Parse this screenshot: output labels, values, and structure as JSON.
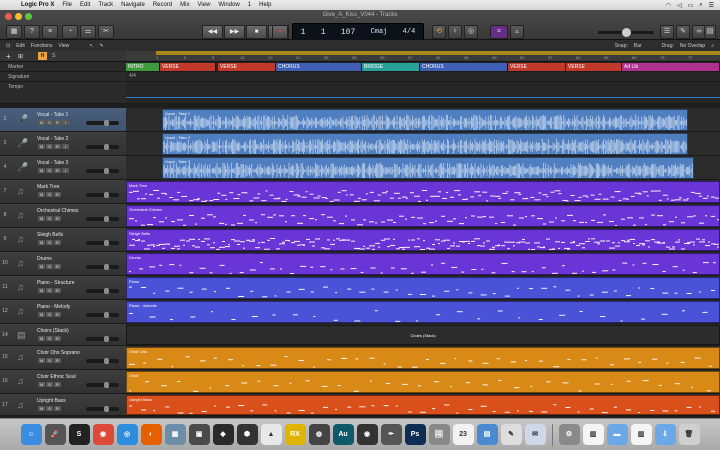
{
  "menubar": {
    "apple": "",
    "app": "Logic Pro X",
    "items": [
      "File",
      "Edit",
      "Track",
      "Navigate",
      "Record",
      "Mix",
      "View",
      "Window",
      "1",
      "Help"
    ]
  },
  "window": {
    "title": "Give_A_Kiss_V044 - Tracks"
  },
  "transport": {
    "rewind": "◀◀",
    "forward": "▶▶",
    "stop": "■",
    "play": "▶",
    "record": "●"
  },
  "lcd": {
    "bar": "1",
    "beat": "1",
    "tempo": "107",
    "key": "C",
    "key_mode": "maj",
    "sig_top": "4",
    "sig_bottom": "4"
  },
  "toolbar2": {
    "edit": "Edit",
    "functions": "Functions",
    "view": "View",
    "snap_label": "Snap:",
    "snap_value": "Bar",
    "drag_label": "Drag:",
    "drag_value": "No Overlap"
  },
  "ruler": {
    "bars": [
      "1",
      "5",
      "9",
      "13",
      "17",
      "21",
      "25",
      "29",
      "33",
      "37",
      "41",
      "45",
      "49",
      "53",
      "57",
      "61",
      "65",
      "69",
      "73",
      "77"
    ]
  },
  "global_tracks": [
    {
      "label": "Marker"
    },
    {
      "label": "Signature"
    },
    {
      "label": "Tempo"
    }
  ],
  "arrangement": [
    {
      "label": "INTRO",
      "color": "#3d9a3d"
    },
    {
      "label": "VERSE",
      "color": "#c0392b"
    },
    {
      "label": "VERSE",
      "color": "#c0392b"
    },
    {
      "label": "CHORUS",
      "color": "#3f5fb5"
    },
    {
      "label": "BRIDGE",
      "color": "#2aa198"
    },
    {
      "label": "CHORUS",
      "color": "#3f5fb5"
    },
    {
      "label": "VERSE",
      "color": "#c0392b"
    },
    {
      "label": "VERSE",
      "color": "#c0392b"
    },
    {
      "label": "Ad Lib",
      "color": "#b0308f"
    }
  ],
  "tracks": [
    {
      "num": "2",
      "name": "Vocal - Take 1",
      "icon": "mic-icon",
      "region": "Vocal - Take 1",
      "color": "#4f7fc0",
      "type": "audio"
    },
    {
      "num": "3",
      "name": "Vocal - Take 2",
      "icon": "mic-icon",
      "region": "Vocal - Take 2",
      "color": "#4f7fc0",
      "type": "audio"
    },
    {
      "num": "4",
      "name": "Vocal - Take 3",
      "icon": "mic-icon",
      "region": "Vocal - Take 3",
      "color": "#4f7fc0",
      "type": "audio"
    },
    {
      "num": "7",
      "name": "Mark Tree",
      "icon": "percussion-icon",
      "region": "Mark Tree",
      "color": "#6a35d6",
      "type": "midi"
    },
    {
      "num": "8",
      "name": "Orchestral Chimes",
      "icon": "chimes-icon",
      "region": "Orchestral Chimes",
      "color": "#6a35d6",
      "type": "midi"
    },
    {
      "num": "9",
      "name": "Sleigh Bells",
      "icon": "bells-icon",
      "region": "Sleigh Bells",
      "color": "#6a35d6",
      "type": "midi"
    },
    {
      "num": "10",
      "name": "Drums",
      "icon": "drums-icon",
      "region": "Drums",
      "color": "#6a35d6",
      "type": "midi"
    },
    {
      "num": "11",
      "name": "Piano - Structure",
      "icon": "keyboard-icon",
      "region": "Piano",
      "color": "#4a52d8",
      "type": "midi"
    },
    {
      "num": "12",
      "name": "Piano - Melody",
      "icon": "keyboard-icon",
      "region": "Piano - melodie",
      "color": "#4a52d8",
      "type": "midi"
    },
    {
      "num": "14",
      "name": "Choirs (Stack)",
      "icon": "choir-icon",
      "region": "Choirs (Stack)",
      "color": "#2c2c2c",
      "type": "stack"
    },
    {
      "num": "15",
      "name": "Choir Ohs Soprano",
      "icon": "choir-icon",
      "region": "Choir Ohs",
      "color": "#d98a16",
      "type": "midi"
    },
    {
      "num": "16",
      "name": "Choir Ethnic Soul",
      "icon": "choir-icon",
      "region": "Choir",
      "color": "#d98a16",
      "type": "midi"
    },
    {
      "num": "17",
      "name": "Upright Bass",
      "icon": "bass-icon",
      "region": "Upright Bass",
      "color": "#d9501a",
      "type": "midi"
    }
  ],
  "track_buttons": {
    "mute": "M",
    "solo": "S",
    "rec": "R",
    "input": "I"
  },
  "dock": [
    {
      "name": "Finder",
      "icon": "finder-icon",
      "color": "#3b8de0",
      "glyph": "☺"
    },
    {
      "name": "Launchpad",
      "icon": "launchpad-icon",
      "color": "#555",
      "glyph": "🚀"
    },
    {
      "name": "Sublime",
      "icon": "app-icon",
      "color": "#222",
      "glyph": "S"
    },
    {
      "name": "Chrome",
      "icon": "chrome-icon",
      "color": "#dd4a3a",
      "glyph": "◉"
    },
    {
      "name": "Safari",
      "icon": "safari-icon",
      "color": "#2f8de0",
      "glyph": "◎"
    },
    {
      "name": "Firefox",
      "icon": "firefox-icon",
      "color": "#e66000",
      "glyph": "◐"
    },
    {
      "name": "Photos",
      "icon": "photos-icon",
      "color": "#6d8ea8",
      "glyph": "▦"
    },
    {
      "name": "Screen",
      "icon": "app-icon",
      "color": "#4a4a4a",
      "glyph": "▣"
    },
    {
      "name": "Logic",
      "icon": "logic-icon",
      "color": "#2a2a2a",
      "glyph": "◆"
    },
    {
      "name": "Setapp",
      "icon": "app-icon",
      "color": "#333",
      "glyph": "⬢"
    },
    {
      "name": "Mixer",
      "icon": "app-icon",
      "color": "#e8e8e8",
      "glyph": "▲"
    },
    {
      "name": "RX",
      "icon": "app-icon",
      "color": "#e0b400",
      "glyph": "RX"
    },
    {
      "name": "Cinema",
      "icon": "app-icon",
      "color": "#444",
      "glyph": "◍"
    },
    {
      "name": "Audition",
      "icon": "audition-icon",
      "color": "#0e5a6a",
      "glyph": "Au"
    },
    {
      "name": "Tool",
      "icon": "app-icon",
      "color": "#333",
      "glyph": "◉"
    },
    {
      "name": "Pen",
      "icon": "app-icon",
      "color": "#555",
      "glyph": "✒"
    },
    {
      "name": "Photoshop",
      "icon": "photoshop-icon",
      "color": "#0d2d52",
      "glyph": "Ps"
    },
    {
      "name": "Preview",
      "icon": "app-icon",
      "color": "#888",
      "glyph": "🖼"
    },
    {
      "name": "Calendar",
      "icon": "calendar-icon",
      "color": "#f2f2f2",
      "glyph": "23"
    },
    {
      "name": "Keynote",
      "icon": "app-icon",
      "color": "#4a8ad0",
      "glyph": "▤"
    },
    {
      "name": "TextEdit",
      "icon": "app-icon",
      "color": "#ddd",
      "glyph": "✎"
    },
    {
      "name": "Mail",
      "icon": "app-icon",
      "color": "#cfd8e8",
      "glyph": "✉"
    },
    {
      "name": "Settings",
      "icon": "gear-icon",
      "color": "#8a8a8a",
      "glyph": "⚙"
    },
    {
      "name": "Doc",
      "icon": "doc-icon",
      "color": "#f5f5f5",
      "glyph": "▥"
    },
    {
      "name": "Folder",
      "icon": "folder-icon",
      "color": "#6aa8e8",
      "glyph": "▬"
    },
    {
      "name": "Doc2",
      "icon": "doc-icon",
      "color": "#f5f5f5",
      "glyph": "▥"
    },
    {
      "name": "Downloads",
      "icon": "downloads-icon",
      "color": "#6aa8e8",
      "glyph": "⇩"
    },
    {
      "name": "Trash",
      "icon": "trash-icon",
      "color": "#cfcfcf",
      "glyph": "🗑"
    }
  ]
}
